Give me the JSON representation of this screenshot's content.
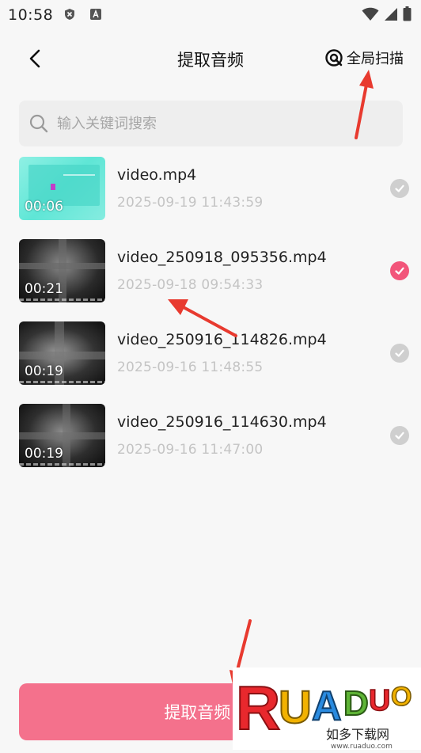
{
  "status": {
    "time": "10:58"
  },
  "header": {
    "title": "提取音频",
    "scan_label": "全局扫描"
  },
  "search": {
    "placeholder": "输入关键词搜索"
  },
  "files": [
    {
      "name": "video.mp4",
      "date": "2025-09-19  11:43:59",
      "duration": "00:06",
      "selected": false
    },
    {
      "name": "video_250918_095356.mp4",
      "date": "2025-09-18  09:54:33",
      "duration": "00:21",
      "selected": true
    },
    {
      "name": "video_250916_114826.mp4",
      "date": "2025-09-16  11:48:55",
      "duration": "00:19",
      "selected": false
    },
    {
      "name": "video_250916_114630.mp4",
      "date": "2025-09-16  11:47:00",
      "duration": "00:19",
      "selected": false
    }
  ],
  "footer": {
    "extract_label": "提取音频（1"
  },
  "watermark": {
    "brand": "RUANDUO",
    "caption": "如多下载网",
    "url": "www.ruaduo.com"
  },
  "colors": {
    "accent": "#f4718c",
    "selected_check": "#f2557a",
    "unselected_check": "#cfcfcf",
    "arrow": "#e83a2f"
  }
}
